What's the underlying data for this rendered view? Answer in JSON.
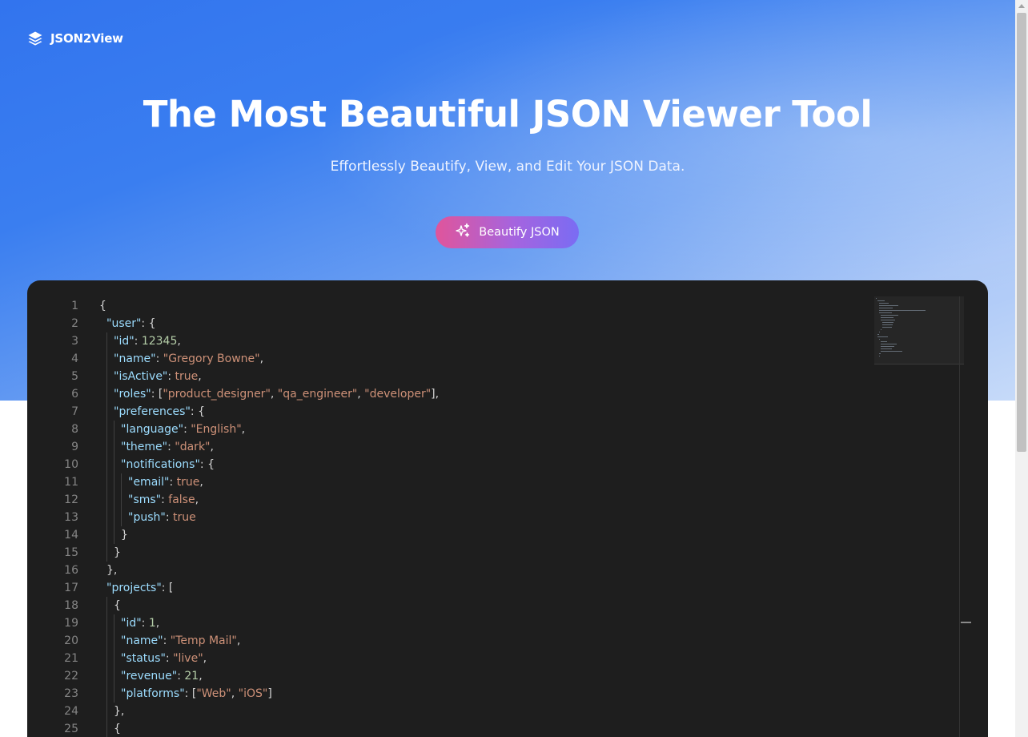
{
  "brand": {
    "name": "JSON2View",
    "icon": "layers-icon"
  },
  "hero": {
    "title": "The Most Beautiful JSON Viewer Tool",
    "subtitle": "Effortlessly Beautify, View, and Edit Your JSON Data.",
    "cta_label": "Beautify JSON",
    "cta_icon": "sparkles-icon"
  },
  "editor": {
    "lines": [
      {
        "n": "1",
        "indent": 0,
        "tokens": [
          [
            "p",
            "{"
          ]
        ]
      },
      {
        "n": "2",
        "indent": 1,
        "tokens": [
          [
            "k",
            "\"user\""
          ],
          [
            "p",
            ": {"
          ]
        ]
      },
      {
        "n": "3",
        "indent": 2,
        "tokens": [
          [
            "k",
            "\"id\""
          ],
          [
            "p",
            ": "
          ],
          [
            "n",
            "12345"
          ],
          [
            "p",
            ","
          ]
        ]
      },
      {
        "n": "4",
        "indent": 2,
        "tokens": [
          [
            "k",
            "\"name\""
          ],
          [
            "p",
            ": "
          ],
          [
            "s",
            "\"Gregory Bowne\""
          ],
          [
            "p",
            ","
          ]
        ]
      },
      {
        "n": "5",
        "indent": 2,
        "tokens": [
          [
            "k",
            "\"isActive\""
          ],
          [
            "p",
            ": "
          ],
          [
            "b",
            "true"
          ],
          [
            "p",
            ","
          ]
        ]
      },
      {
        "n": "6",
        "indent": 2,
        "tokens": [
          [
            "k",
            "\"roles\""
          ],
          [
            "p",
            ": ["
          ],
          [
            "s",
            "\"product_designer\""
          ],
          [
            "p",
            ", "
          ],
          [
            "s",
            "\"qa_engineer\""
          ],
          [
            "p",
            ", "
          ],
          [
            "s",
            "\"developer\""
          ],
          [
            "p",
            "],"
          ]
        ]
      },
      {
        "n": "7",
        "indent": 2,
        "tokens": [
          [
            "k",
            "\"preferences\""
          ],
          [
            "p",
            ": {"
          ]
        ]
      },
      {
        "n": "8",
        "indent": 3,
        "tokens": [
          [
            "k",
            "\"language\""
          ],
          [
            "p",
            ": "
          ],
          [
            "s",
            "\"English\""
          ],
          [
            "p",
            ","
          ]
        ]
      },
      {
        "n": "9",
        "indent": 3,
        "tokens": [
          [
            "k",
            "\"theme\""
          ],
          [
            "p",
            ": "
          ],
          [
            "s",
            "\"dark\""
          ],
          [
            "p",
            ","
          ]
        ]
      },
      {
        "n": "10",
        "indent": 3,
        "tokens": [
          [
            "k",
            "\"notifications\""
          ],
          [
            "p",
            ": {"
          ]
        ]
      },
      {
        "n": "11",
        "indent": 4,
        "tokens": [
          [
            "k",
            "\"email\""
          ],
          [
            "p",
            ": "
          ],
          [
            "b",
            "true"
          ],
          [
            "p",
            ","
          ]
        ]
      },
      {
        "n": "12",
        "indent": 4,
        "tokens": [
          [
            "k",
            "\"sms\""
          ],
          [
            "p",
            ": "
          ],
          [
            "b",
            "false"
          ],
          [
            "p",
            ","
          ]
        ]
      },
      {
        "n": "13",
        "indent": 4,
        "tokens": [
          [
            "k",
            "\"push\""
          ],
          [
            "p",
            ": "
          ],
          [
            "b",
            "true"
          ]
        ]
      },
      {
        "n": "14",
        "indent": 3,
        "tokens": [
          [
            "p",
            "}"
          ]
        ]
      },
      {
        "n": "15",
        "indent": 2,
        "tokens": [
          [
            "p",
            "}"
          ]
        ]
      },
      {
        "n": "16",
        "indent": 1,
        "tokens": [
          [
            "p",
            "},"
          ]
        ]
      },
      {
        "n": "17",
        "indent": 1,
        "tokens": [
          [
            "k",
            "\"projects\""
          ],
          [
            "p",
            ": ["
          ]
        ]
      },
      {
        "n": "18",
        "indent": 2,
        "tokens": [
          [
            "p",
            "{"
          ]
        ]
      },
      {
        "n": "19",
        "indent": 3,
        "tokens": [
          [
            "k",
            "\"id\""
          ],
          [
            "p",
            ": "
          ],
          [
            "n",
            "1"
          ],
          [
            "p",
            ","
          ]
        ]
      },
      {
        "n": "20",
        "indent": 3,
        "tokens": [
          [
            "k",
            "\"name\""
          ],
          [
            "p",
            ": "
          ],
          [
            "s",
            "\"Temp Mail\""
          ],
          [
            "p",
            ","
          ]
        ]
      },
      {
        "n": "21",
        "indent": 3,
        "tokens": [
          [
            "k",
            "\"status\""
          ],
          [
            "p",
            ": "
          ],
          [
            "s",
            "\"live\""
          ],
          [
            "p",
            ","
          ]
        ]
      },
      {
        "n": "22",
        "indent": 3,
        "tokens": [
          [
            "k",
            "\"revenue\""
          ],
          [
            "p",
            ": "
          ],
          [
            "n",
            "21"
          ],
          [
            "p",
            ","
          ]
        ]
      },
      {
        "n": "23",
        "indent": 3,
        "tokens": [
          [
            "k",
            "\"platforms\""
          ],
          [
            "p",
            ": ["
          ],
          [
            "s",
            "\"Web\""
          ],
          [
            "p",
            ", "
          ],
          [
            "s",
            "\"iOS\""
          ],
          [
            "p",
            "]"
          ]
        ]
      },
      {
        "n": "24",
        "indent": 2,
        "tokens": [
          [
            "p",
            "},"
          ]
        ]
      },
      {
        "n": "25",
        "indent": 2,
        "tokens": [
          [
            "p",
            "{"
          ]
        ]
      }
    ]
  }
}
